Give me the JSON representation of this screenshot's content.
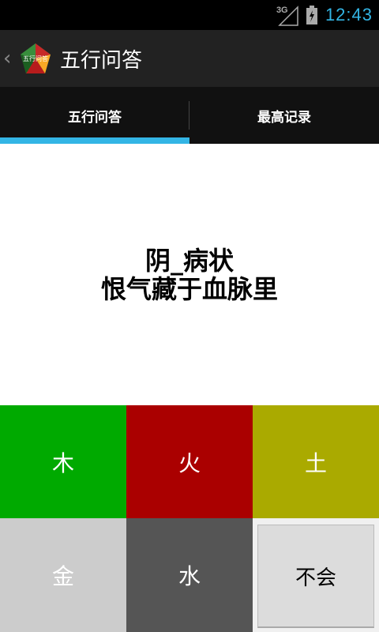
{
  "status_bar": {
    "network": "3G",
    "time": "12:43"
  },
  "action_bar": {
    "logo_text": "五行问答",
    "title": "五行问答"
  },
  "tabs": [
    {
      "label": "五行问答",
      "selected": true
    },
    {
      "label": "最高记录",
      "selected": false
    }
  ],
  "question": {
    "line1": "阴_病状",
    "line2": "恨气藏于血脉里"
  },
  "answers": [
    {
      "label": "木",
      "color": "#00aa00"
    },
    {
      "label": "火",
      "color": "#aa0000"
    },
    {
      "label": "土",
      "color": "#aaaa00"
    },
    {
      "label": "金",
      "color": "#cccccc"
    },
    {
      "label": "水",
      "color": "#555555"
    },
    {
      "label": "不会",
      "color": "#dddddd"
    }
  ],
  "colors": {
    "accent": "#33b5e5",
    "action_bar_bg": "#222222",
    "tab_bar_bg": "#111111"
  }
}
